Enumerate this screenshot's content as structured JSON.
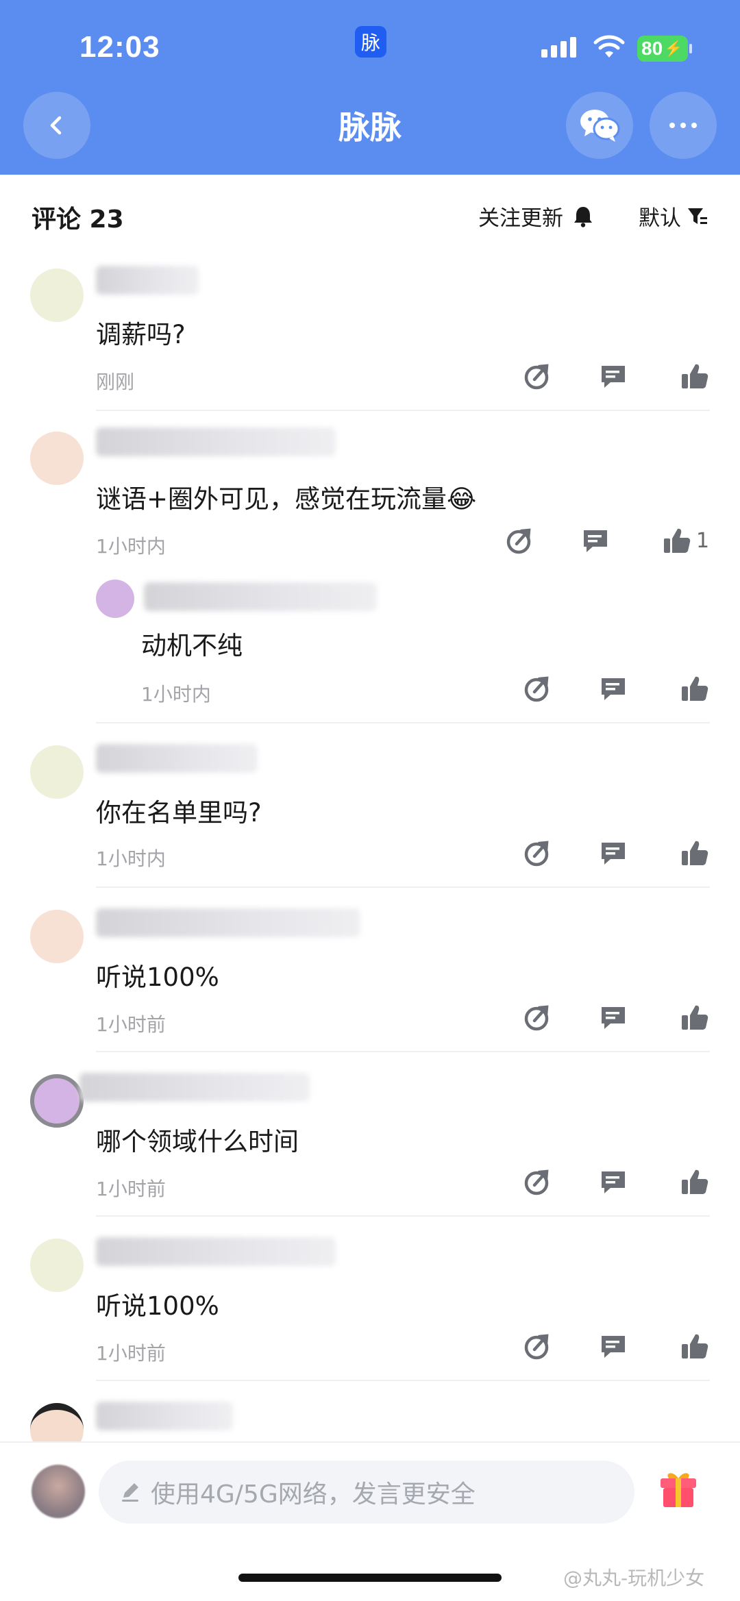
{
  "status_bar": {
    "time": "12:03",
    "app_badge": "脉",
    "battery": "80"
  },
  "nav": {
    "title": "脉脉"
  },
  "comments_header": {
    "title": "评论 23",
    "follow_update": "关注更新",
    "sort": "默认"
  },
  "comments": [
    {
      "text": "调薪吗?",
      "time": "刚刚",
      "likes": ""
    },
    {
      "text": "谜语+圈外可见，感觉在玩流量😂",
      "time": "1小时内",
      "likes": "1",
      "reply": {
        "text": "动机不纯",
        "time": "1小时内"
      }
    },
    {
      "text": "你在名单里吗?",
      "time": "1小时内",
      "likes": ""
    },
    {
      "text": "听说100%",
      "time": "1小时前",
      "likes": ""
    },
    {
      "text": "哪个领域什么时间",
      "time": "1小时前",
      "likes": ""
    },
    {
      "text": "听说100%",
      "time": "1小时前",
      "likes": ""
    }
  ],
  "input": {
    "placeholder": "使用4G/5G网络，发言更安全"
  },
  "watermark": "@丸丸-玩机少女",
  "colors": {
    "header_blue": "#5b8df0",
    "icon_gray": "#6b6d74",
    "time_gray": "#a3a3a8"
  },
  "icons": [
    "back-icon",
    "wechat-icon",
    "more-icon",
    "bell-icon",
    "filter-icon",
    "share-icon",
    "reply-icon",
    "like-icon",
    "pen-icon",
    "gift-icon"
  ]
}
